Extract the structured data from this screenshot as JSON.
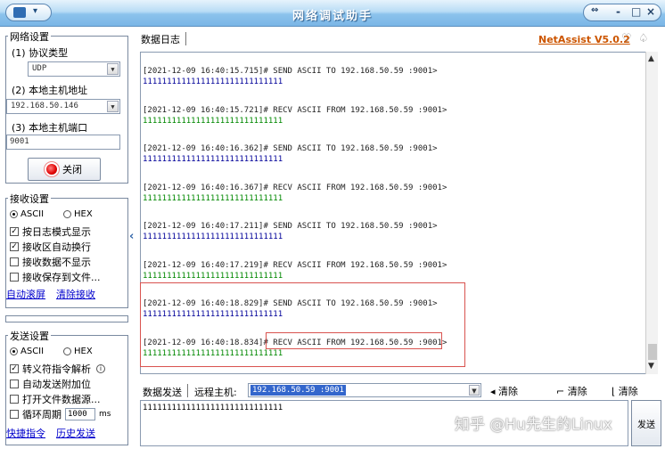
{
  "window": {
    "title": "网络调试助手",
    "buttons": {
      "minimize": "-",
      "restore": "□",
      "close": "×"
    }
  },
  "network_settings": {
    "group_title": "网络设置",
    "protocol_label": "(1) 协议类型",
    "protocol_value": "UDP",
    "local_host_label": "(2) 本地主机地址",
    "local_host_value": "192.168.50.146",
    "local_port_label": "(3) 本地主机端口",
    "local_port_value": "9001",
    "close_button": "关闭"
  },
  "receive_settings": {
    "group_title": "接收设置",
    "radio_ascii": "ASCII",
    "radio_hex": "HEX",
    "selected": "ASCII",
    "check_log_mode": "按日志模式显示",
    "check_auto_wrap": "接收区自动换行",
    "check_hide": "接收数据不显示",
    "check_save": "接收保存到文件...",
    "link_auto_scroll": "自动滚屏",
    "link_clear": "清除接收"
  },
  "send_settings": {
    "group_title": "发送设置",
    "radio_ascii": "ASCII",
    "radio_hex": "HEX",
    "selected": "ASCII",
    "check_escape": "转义符指令解析",
    "check_append": "自动发送附加位",
    "check_file_source": "打开文件数据源...",
    "check_cycle": "循环周期",
    "cycle_value": "1000",
    "cycle_unit": "ms",
    "link_shortcut": "快捷指令",
    "link_history": "历史发送"
  },
  "log": {
    "header": "数据日志",
    "brand": "NetAssist V5.0.2",
    "entries": [
      {
        "head": "[2021-12-09 16:40:15.715]# SEND ASCII TO 192.168.50.59 :9001>",
        "data": "11111111111111111111111111111",
        "type": "send"
      },
      {
        "head": "[2021-12-09 16:40:15.721]# RECV ASCII FROM 192.168.50.59 :9001>",
        "data": "11111111111111111111111111111",
        "type": "recv"
      },
      {
        "head": "[2021-12-09 16:40:16.362]# SEND ASCII TO 192.168.50.59 :9001>",
        "data": "11111111111111111111111111111",
        "type": "send"
      },
      {
        "head": "[2021-12-09 16:40:16.367]# RECV ASCII FROM 192.168.50.59 :9001>",
        "data": "11111111111111111111111111111",
        "type": "recv"
      },
      {
        "head": "[2021-12-09 16:40:17.211]# SEND ASCII TO 192.168.50.59 :9001>",
        "data": "11111111111111111111111111111",
        "type": "send"
      },
      {
        "head": "[2021-12-09 16:40:17.219]# RECV ASCII FROM 192.168.50.59 :9001>",
        "data": "11111111111111111111111111111",
        "type": "recv"
      },
      {
        "head": "[2021-12-09 16:40:18.829]# SEND ASCII TO 192.168.50.59 :9001>",
        "data": "11111111111111111111111111111",
        "type": "send"
      },
      {
        "head": "[2021-12-09 16:40:18.834]# RECV ASCII FROM 192.168.50.59 :9001>",
        "data": "11111111111111111111111111111",
        "type": "recv"
      }
    ]
  },
  "send_area": {
    "label": "数据发送",
    "remote_label": "远程主机:",
    "remote_value": "192.168.50.59 :9001",
    "clear1": "清除",
    "clear2": "清除",
    "clear3": "清除",
    "text": "11111111111111111111111111111",
    "send_button": "发送"
  },
  "watermark": "知乎 @Hu先生的Linux",
  "colors": {
    "send_data": "#000099",
    "recv_data": "#008800",
    "brand": "#cc5500",
    "highlight": "#d9534f",
    "link": "#0000cc"
  }
}
